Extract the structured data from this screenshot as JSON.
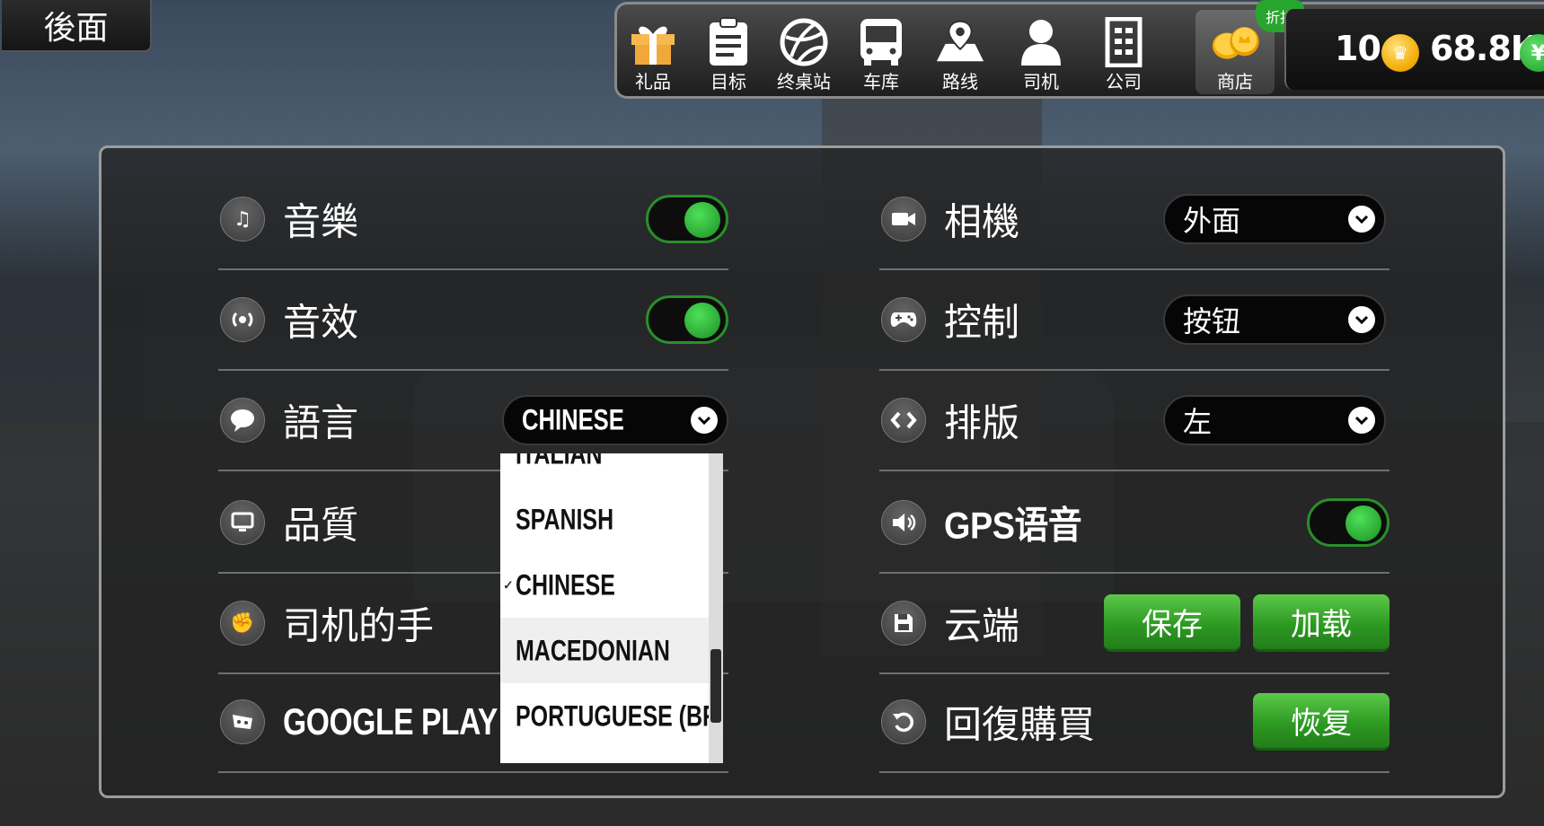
{
  "back_button": "後面",
  "nav": [
    {
      "label": "礼品",
      "icon": "gift-icon"
    },
    {
      "label": "目标",
      "icon": "clipboard-icon"
    },
    {
      "label": "终桌站",
      "icon": "globe-icon"
    },
    {
      "label": "车库",
      "icon": "bus-icon"
    },
    {
      "label": "路线",
      "icon": "map-pin-icon"
    },
    {
      "label": "司机",
      "icon": "driver-icon"
    },
    {
      "label": "公司",
      "icon": "building-icon"
    },
    {
      "label": "商店",
      "icon": "coins-icon"
    }
  ],
  "discount_badge": "折扣",
  "currency": {
    "coins": "10",
    "cash": "68.8K",
    "cash_symbol": "¥"
  },
  "settings_left": {
    "music": {
      "label": "音樂",
      "on": true
    },
    "sound_effects": {
      "label": "音效",
      "on": true
    },
    "language": {
      "label": "語言",
      "value": "CHINESE"
    },
    "quality": {
      "label": "品質"
    },
    "driver_hands": {
      "label": "司机的手"
    },
    "google_play": {
      "label": "GOOGLE PLAY"
    }
  },
  "settings_right": {
    "camera": {
      "label": "相機",
      "value": "外面"
    },
    "control": {
      "label": "控制",
      "value": "按钮"
    },
    "layout": {
      "label": "排版",
      "value": "左"
    },
    "gps_voice": {
      "label": "GPS语音",
      "on": true
    },
    "cloud": {
      "label": "云端",
      "save": "保存",
      "load": "加载"
    },
    "restore": {
      "label": "回復購買",
      "button": "恢复"
    }
  },
  "language_dropdown": {
    "items": [
      "ITALIAN",
      "SPANISH",
      "CHINESE",
      "MACEDONIAN",
      "PORTUGUESE (BR)"
    ],
    "selected": "CHINESE",
    "highlighted": "MACEDONIAN"
  },
  "colors": {
    "accent_green": "#2d9a22",
    "toggle_knob": "#1b8e23"
  }
}
